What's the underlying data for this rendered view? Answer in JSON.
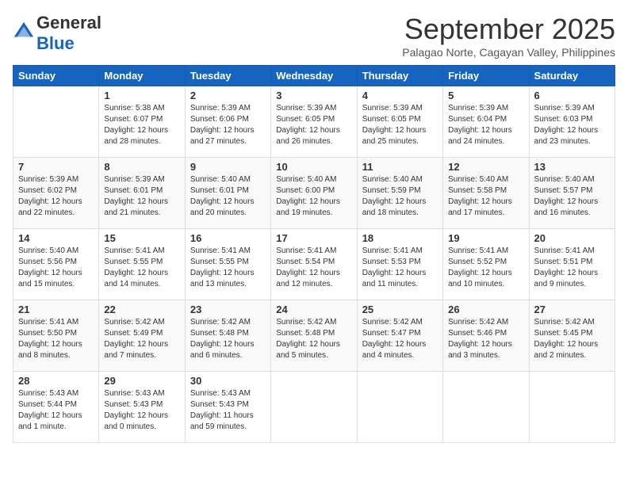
{
  "logo": {
    "text_general": "General",
    "text_blue": "Blue"
  },
  "title": {
    "month": "September 2025",
    "subtitle": "Palagao Norte, Cagayan Valley, Philippines"
  },
  "days_of_week": [
    "Sunday",
    "Monday",
    "Tuesday",
    "Wednesday",
    "Thursday",
    "Friday",
    "Saturday"
  ],
  "weeks": [
    [
      {
        "day": "",
        "sunrise": "",
        "sunset": "",
        "daylight": ""
      },
      {
        "day": "1",
        "sunrise": "Sunrise: 5:38 AM",
        "sunset": "Sunset: 6:07 PM",
        "daylight": "Daylight: 12 hours and 28 minutes."
      },
      {
        "day": "2",
        "sunrise": "Sunrise: 5:39 AM",
        "sunset": "Sunset: 6:06 PM",
        "daylight": "Daylight: 12 hours and 27 minutes."
      },
      {
        "day": "3",
        "sunrise": "Sunrise: 5:39 AM",
        "sunset": "Sunset: 6:05 PM",
        "daylight": "Daylight: 12 hours and 26 minutes."
      },
      {
        "day": "4",
        "sunrise": "Sunrise: 5:39 AM",
        "sunset": "Sunset: 6:05 PM",
        "daylight": "Daylight: 12 hours and 25 minutes."
      },
      {
        "day": "5",
        "sunrise": "Sunrise: 5:39 AM",
        "sunset": "Sunset: 6:04 PM",
        "daylight": "Daylight: 12 hours and 24 minutes."
      },
      {
        "day": "6",
        "sunrise": "Sunrise: 5:39 AM",
        "sunset": "Sunset: 6:03 PM",
        "daylight": "Daylight: 12 hours and 23 minutes."
      }
    ],
    [
      {
        "day": "7",
        "sunrise": "Sunrise: 5:39 AM",
        "sunset": "Sunset: 6:02 PM",
        "daylight": "Daylight: 12 hours and 22 minutes."
      },
      {
        "day": "8",
        "sunrise": "Sunrise: 5:39 AM",
        "sunset": "Sunset: 6:01 PM",
        "daylight": "Daylight: 12 hours and 21 minutes."
      },
      {
        "day": "9",
        "sunrise": "Sunrise: 5:40 AM",
        "sunset": "Sunset: 6:01 PM",
        "daylight": "Daylight: 12 hours and 20 minutes."
      },
      {
        "day": "10",
        "sunrise": "Sunrise: 5:40 AM",
        "sunset": "Sunset: 6:00 PM",
        "daylight": "Daylight: 12 hours and 19 minutes."
      },
      {
        "day": "11",
        "sunrise": "Sunrise: 5:40 AM",
        "sunset": "Sunset: 5:59 PM",
        "daylight": "Daylight: 12 hours and 18 minutes."
      },
      {
        "day": "12",
        "sunrise": "Sunrise: 5:40 AM",
        "sunset": "Sunset: 5:58 PM",
        "daylight": "Daylight: 12 hours and 17 minutes."
      },
      {
        "day": "13",
        "sunrise": "Sunrise: 5:40 AM",
        "sunset": "Sunset: 5:57 PM",
        "daylight": "Daylight: 12 hours and 16 minutes."
      }
    ],
    [
      {
        "day": "14",
        "sunrise": "Sunrise: 5:40 AM",
        "sunset": "Sunset: 5:56 PM",
        "daylight": "Daylight: 12 hours and 15 minutes."
      },
      {
        "day": "15",
        "sunrise": "Sunrise: 5:41 AM",
        "sunset": "Sunset: 5:55 PM",
        "daylight": "Daylight: 12 hours and 14 minutes."
      },
      {
        "day": "16",
        "sunrise": "Sunrise: 5:41 AM",
        "sunset": "Sunset: 5:55 PM",
        "daylight": "Daylight: 12 hours and 13 minutes."
      },
      {
        "day": "17",
        "sunrise": "Sunrise: 5:41 AM",
        "sunset": "Sunset: 5:54 PM",
        "daylight": "Daylight: 12 hours and 12 minutes."
      },
      {
        "day": "18",
        "sunrise": "Sunrise: 5:41 AM",
        "sunset": "Sunset: 5:53 PM",
        "daylight": "Daylight: 12 hours and 11 minutes."
      },
      {
        "day": "19",
        "sunrise": "Sunrise: 5:41 AM",
        "sunset": "Sunset: 5:52 PM",
        "daylight": "Daylight: 12 hours and 10 minutes."
      },
      {
        "day": "20",
        "sunrise": "Sunrise: 5:41 AM",
        "sunset": "Sunset: 5:51 PM",
        "daylight": "Daylight: 12 hours and 9 minutes."
      }
    ],
    [
      {
        "day": "21",
        "sunrise": "Sunrise: 5:41 AM",
        "sunset": "Sunset: 5:50 PM",
        "daylight": "Daylight: 12 hours and 8 minutes."
      },
      {
        "day": "22",
        "sunrise": "Sunrise: 5:42 AM",
        "sunset": "Sunset: 5:49 PM",
        "daylight": "Daylight: 12 hours and 7 minutes."
      },
      {
        "day": "23",
        "sunrise": "Sunrise: 5:42 AM",
        "sunset": "Sunset: 5:48 PM",
        "daylight": "Daylight: 12 hours and 6 minutes."
      },
      {
        "day": "24",
        "sunrise": "Sunrise: 5:42 AM",
        "sunset": "Sunset: 5:48 PM",
        "daylight": "Daylight: 12 hours and 5 minutes."
      },
      {
        "day": "25",
        "sunrise": "Sunrise: 5:42 AM",
        "sunset": "Sunset: 5:47 PM",
        "daylight": "Daylight: 12 hours and 4 minutes."
      },
      {
        "day": "26",
        "sunrise": "Sunrise: 5:42 AM",
        "sunset": "Sunset: 5:46 PM",
        "daylight": "Daylight: 12 hours and 3 minutes."
      },
      {
        "day": "27",
        "sunrise": "Sunrise: 5:42 AM",
        "sunset": "Sunset: 5:45 PM",
        "daylight": "Daylight: 12 hours and 2 minutes."
      }
    ],
    [
      {
        "day": "28",
        "sunrise": "Sunrise: 5:43 AM",
        "sunset": "Sunset: 5:44 PM",
        "daylight": "Daylight: 12 hours and 1 minute."
      },
      {
        "day": "29",
        "sunrise": "Sunrise: 5:43 AM",
        "sunset": "Sunset: 5:43 PM",
        "daylight": "Daylight: 12 hours and 0 minutes."
      },
      {
        "day": "30",
        "sunrise": "Sunrise: 5:43 AM",
        "sunset": "Sunset: 5:43 PM",
        "daylight": "Daylight: 11 hours and 59 minutes."
      },
      {
        "day": "",
        "sunrise": "",
        "sunset": "",
        "daylight": ""
      },
      {
        "day": "",
        "sunrise": "",
        "sunset": "",
        "daylight": ""
      },
      {
        "day": "",
        "sunrise": "",
        "sunset": "",
        "daylight": ""
      },
      {
        "day": "",
        "sunrise": "",
        "sunset": "",
        "daylight": ""
      }
    ]
  ]
}
